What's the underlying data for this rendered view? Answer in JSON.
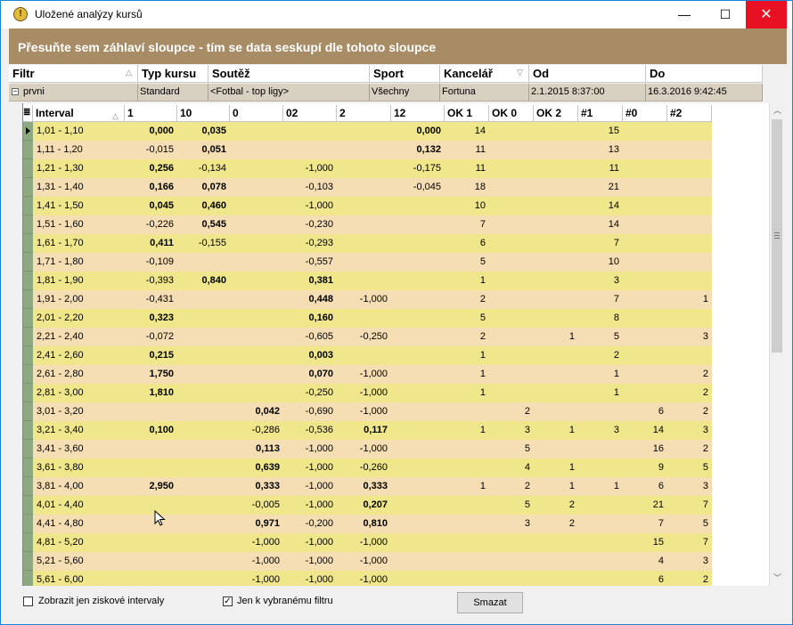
{
  "window": {
    "title": "Uložené analýzy kursů",
    "min": "—",
    "max": "☐",
    "close": "✕"
  },
  "group_panel": "Přesuňte sem záhlaví sloupce - tím se data seskupí dle tohoto sloupce",
  "filter_columns": [
    "Filtr",
    "Typ kursu",
    "Soutěž",
    "Sport",
    "Kancelář",
    "Od",
    "Do"
  ],
  "filter_row": [
    "prvni",
    "Standard",
    "<Fotbal - top ligy>",
    "Všechny",
    "Fortuna",
    "2.1.2015 8:37:00",
    "16.3.2016 9:42:45"
  ],
  "detail_columns": [
    "Interval",
    "1",
    "10",
    "0",
    "02",
    "2",
    "12",
    "OK 1",
    "OK 0",
    "OK 2",
    "#1",
    "#0",
    "#2"
  ],
  "rows": [
    [
      "1,01 - 1,10",
      "0,000",
      "0,035",
      "",
      "",
      "",
      "0,000",
      "14",
      "",
      "",
      "15",
      "",
      ""
    ],
    [
      "1,11 - 1,20",
      "-0,015",
      "0,051",
      "",
      "",
      "",
      "0,132",
      "11",
      "",
      "",
      "13",
      "",
      ""
    ],
    [
      "1,21 - 1,30",
      "0,256",
      "-0,134",
      "",
      "-1,000",
      "",
      "-0,175",
      "11",
      "",
      "",
      "11",
      "",
      ""
    ],
    [
      "1,31 - 1,40",
      "0,166",
      "0,078",
      "",
      "-0,103",
      "",
      "-0,045",
      "18",
      "",
      "",
      "21",
      "",
      ""
    ],
    [
      "1,41 - 1,50",
      "0,045",
      "0,460",
      "",
      "-1,000",
      "",
      "",
      "10",
      "",
      "",
      "14",
      "",
      ""
    ],
    [
      "1,51 - 1,60",
      "-0,226",
      "0,545",
      "",
      "-0,230",
      "",
      "",
      "7",
      "",
      "",
      "14",
      "",
      ""
    ],
    [
      "1,61 - 1,70",
      "0,411",
      "-0,155",
      "",
      "-0,293",
      "",
      "",
      "6",
      "",
      "",
      "7",
      "",
      ""
    ],
    [
      "1,71 - 1,80",
      "-0,109",
      "",
      "",
      "-0,557",
      "",
      "",
      "5",
      "",
      "",
      "10",
      "",
      ""
    ],
    [
      "1,81 - 1,90",
      "-0,393",
      "0,840",
      "",
      "0,381",
      "",
      "",
      "1",
      "",
      "",
      "3",
      "",
      ""
    ],
    [
      "1,91 - 2,00",
      "-0,431",
      "",
      "",
      "0,448",
      "-1,000",
      "",
      "2",
      "",
      "",
      "7",
      "",
      "1"
    ],
    [
      "2,01 - 2,20",
      "0,323",
      "",
      "",
      "0,160",
      "",
      "",
      "5",
      "",
      "",
      "8",
      "",
      ""
    ],
    [
      "2,21 - 2,40",
      "-0,072",
      "",
      "",
      "-0,605",
      "-0,250",
      "",
      "2",
      "",
      "1",
      "5",
      "",
      "3"
    ],
    [
      "2,41 - 2,60",
      "0,215",
      "",
      "",
      "0,003",
      "",
      "",
      "1",
      "",
      "",
      "2",
      "",
      ""
    ],
    [
      "2,61 - 2,80",
      "1,750",
      "",
      "",
      "0,070",
      "-1,000",
      "",
      "1",
      "",
      "",
      "1",
      "",
      "2"
    ],
    [
      "2,81 - 3,00",
      "1,810",
      "",
      "",
      "-0,250",
      "-1,000",
      "",
      "1",
      "",
      "",
      "1",
      "",
      "2"
    ],
    [
      "3,01 - 3,20",
      "",
      "",
      "0,042",
      "-0,690",
      "-1,000",
      "",
      "",
      "2",
      "",
      "",
      "6",
      "2"
    ],
    [
      "3,21 - 3,40",
      "0,100",
      "",
      "-0,286",
      "-0,536",
      "0,117",
      "",
      "1",
      "3",
      "1",
      "3",
      "14",
      "3"
    ],
    [
      "3,41 - 3,60",
      "",
      "",
      "0,113",
      "-1,000",
      "-1,000",
      "",
      "",
      "5",
      "",
      "",
      "16",
      "2"
    ],
    [
      "3,61 - 3,80",
      "",
      "",
      "0,639",
      "-1,000",
      "-0,260",
      "",
      "",
      "4",
      "1",
      "",
      "9",
      "5"
    ],
    [
      "3,81 - 4,00",
      "2,950",
      "",
      "0,333",
      "-1,000",
      "0,333",
      "",
      "1",
      "2",
      "1",
      "1",
      "6",
      "3"
    ],
    [
      "4,01 - 4,40",
      "",
      "",
      "-0,005",
      "-1,000",
      "0,207",
      "",
      "",
      "5",
      "2",
      "",
      "21",
      "7"
    ],
    [
      "4,41 - 4,80",
      "",
      "",
      "0,971",
      "-0,200",
      "0,810",
      "",
      "",
      "3",
      "2",
      "",
      "7",
      "5"
    ],
    [
      "4,81 - 5,20",
      "",
      "",
      "-1,000",
      "-1,000",
      "-1,000",
      "",
      "",
      "",
      "",
      "",
      "15",
      "7"
    ],
    [
      "5,21 - 5,60",
      "",
      "",
      "-1,000",
      "-1,000",
      "-1,000",
      "",
      "",
      "",
      "",
      "",
      "4",
      "3"
    ],
    [
      "5,61 - 6,00",
      "",
      "",
      "-1,000",
      "-1,000",
      "-1,000",
      "",
      "",
      "",
      "",
      "",
      "6",
      "2"
    ]
  ],
  "bold_cells": {
    "0": [
      1,
      2,
      6
    ],
    "1": [
      2,
      6
    ],
    "2": [
      1
    ],
    "3": [
      1,
      2
    ],
    "4": [
      1,
      2
    ],
    "5": [
      2
    ],
    "6": [
      1
    ],
    "8": [
      2,
      4
    ],
    "9": [
      4
    ],
    "10": [
      1,
      4
    ],
    "12": [
      1,
      4
    ],
    "13": [
      1,
      4
    ],
    "14": [
      1
    ],
    "15": [
      3
    ],
    "16": [
      1,
      5
    ],
    "17": [
      3
    ],
    "18": [
      3
    ],
    "19": [
      1,
      3,
      5
    ],
    "20": [
      5
    ],
    "21": [
      3,
      5
    ]
  },
  "bottom": {
    "checkbox1_label": "Zobrazit jen ziskové intervaly",
    "checkbox1_checked": false,
    "checkbox2_label": "Jen k vybranému filtru",
    "checkbox2_checked": true,
    "button_label": "Smazat"
  },
  "colors": {
    "row_even": "#f0e68c",
    "row_odd": "#f5deb3",
    "group_panel": "#a78c66",
    "indicator": "#8ea882"
  }
}
